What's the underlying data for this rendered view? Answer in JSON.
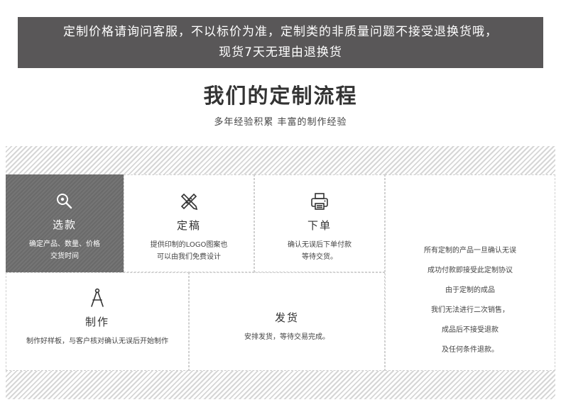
{
  "notice": {
    "line1": "定制价格请询问客服，不以标价为准，定制类的非质量问题不接受退换货哦，",
    "line2": "现货7天无理由退换货"
  },
  "heading": {
    "title": "我们的定制流程",
    "subtitle": "多年经验积累 丰富的制作经验"
  },
  "steps": [
    {
      "icon": "search-zoom-icon",
      "title": "选款",
      "desc1": "确定产品、数量、价格",
      "desc2": "交货时间"
    },
    {
      "icon": "pencil-ruler-icon",
      "title": "定稿",
      "desc1": "提供印制的LOGO图案也",
      "desc2": "可以由我们免费设计"
    },
    {
      "icon": "printer-icon",
      "title": "下单",
      "desc1": "确认无误后下单付款",
      "desc2": "等待交货。"
    },
    {
      "icon": "compass-icon",
      "title": "制作",
      "desc1": "制作好样板，与客户核对确认无误后开始制作",
      "desc2": ""
    },
    {
      "icon": "",
      "title": "发货",
      "desc1": "安排发货，等待交易完成。",
      "desc2": ""
    }
  ],
  "policy": [
    "所有定制的产品一旦确认无误",
    "成功付款即接受此定制协议",
    "由于定制的成品",
    "我们无法进行二次销售，",
    "成品后不接受退款",
    "及任何条件退款。"
  ],
  "colors": {
    "notice_bg": "#595758",
    "dark_cell": "#6f6f6f",
    "stripe": "#d6d6d6"
  }
}
